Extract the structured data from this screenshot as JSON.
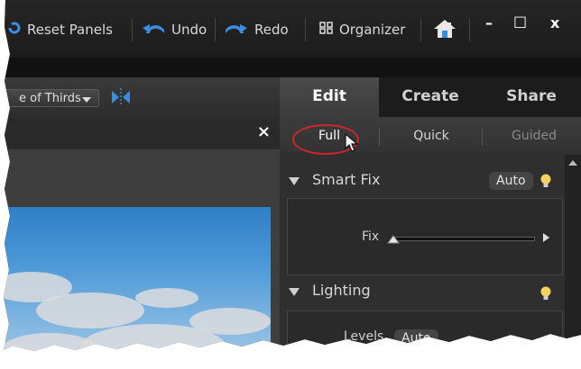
{
  "toolbar": {
    "reset_panels": "Reset Panels",
    "undo": "Undo",
    "redo": "Redo",
    "organizer": "Organizer"
  },
  "window_controls": {
    "minimize": "–",
    "maximize": "□",
    "close": "x"
  },
  "options": {
    "crop_overlay": "e of Thirds"
  },
  "document": {
    "close": "×"
  },
  "panel": {
    "tabs": [
      "Edit",
      "Create",
      "Share"
    ],
    "active_tab": "Edit",
    "modes": [
      "Full",
      "Quick",
      "Guided"
    ],
    "active_mode": "Full",
    "smart_fix": {
      "title": "Smart Fix",
      "auto": "Auto",
      "fix_label": "Fix"
    },
    "lighting": {
      "title": "Lighting",
      "levels_label": "Levels",
      "auto": "Auto"
    }
  },
  "colors": {
    "highlight_circle": "#d0262a",
    "bulb": "#f4d35e",
    "accent_blue": "#3a8ee0"
  }
}
